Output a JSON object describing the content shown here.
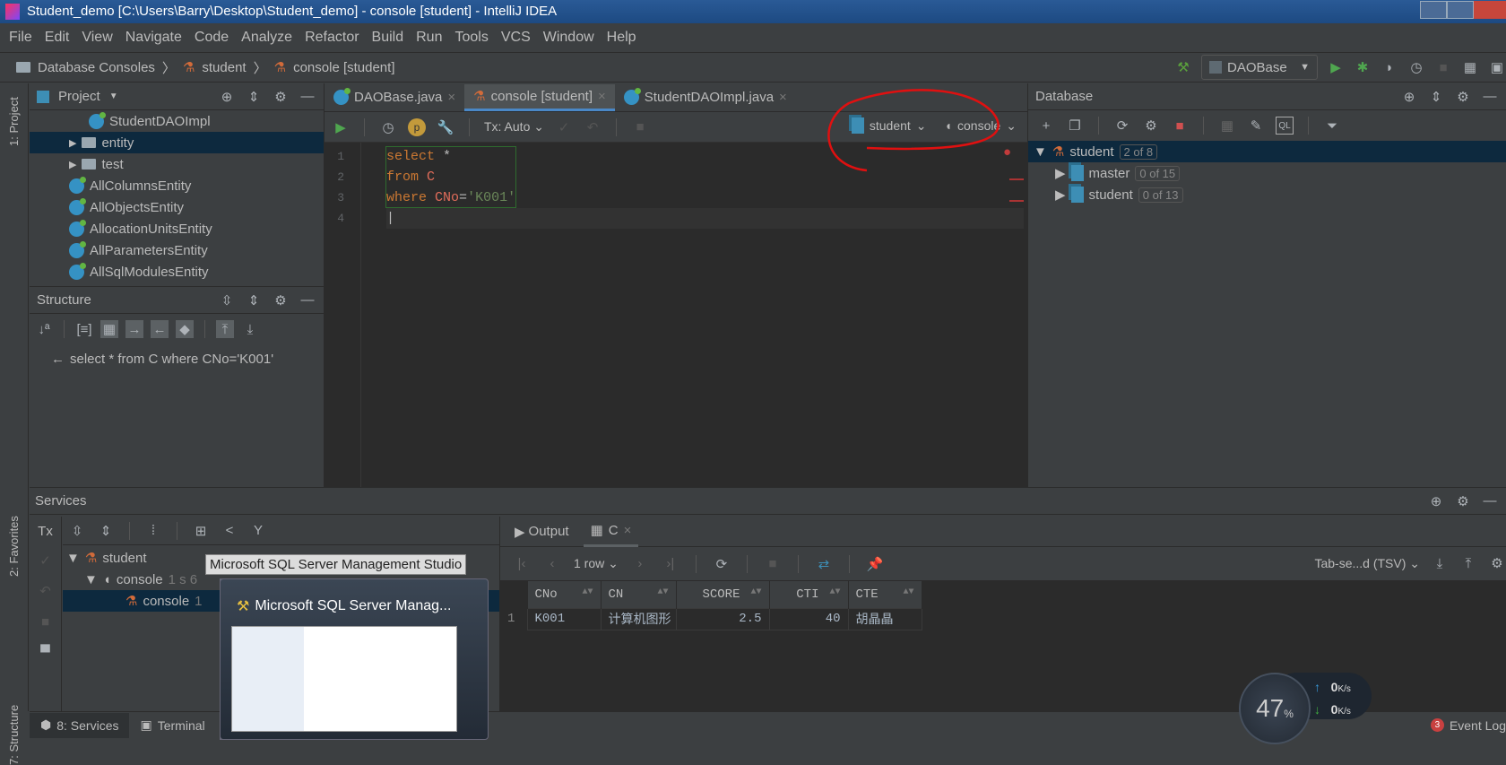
{
  "window": {
    "title": "Student_demo [C:\\Users\\Barry\\Desktop\\Student_demo] - console [student] - IntelliJ IDEA"
  },
  "menu": [
    "File",
    "Edit",
    "View",
    "Navigate",
    "Code",
    "Analyze",
    "Refactor",
    "Build",
    "Run",
    "Tools",
    "VCS",
    "Window",
    "Help"
  ],
  "breadcrumb": [
    "Database Consoles",
    "student",
    "console [student]"
  ],
  "run_config": "DAOBase",
  "side_tabs": {
    "project": "1: Project",
    "favorites": "2: Favorites",
    "structure": "7: Structure"
  },
  "project": {
    "title": "Project",
    "items": [
      {
        "label": "StudentDAOImpl",
        "type": "class",
        "indent": 3
      },
      {
        "label": "entity",
        "type": "folder",
        "indent": 2,
        "selected": true
      },
      {
        "label": "test",
        "type": "folder",
        "indent": 2
      },
      {
        "label": "AllColumnsEntity",
        "type": "class",
        "indent": 2
      },
      {
        "label": "AllObjectsEntity",
        "type": "class",
        "indent": 2
      },
      {
        "label": "AllocationUnitsEntity",
        "type": "class",
        "indent": 2
      },
      {
        "label": "AllParametersEntity",
        "type": "class",
        "indent": 2
      },
      {
        "label": "AllSqlModulesEntity",
        "type": "class",
        "indent": 2
      }
    ]
  },
  "structure": {
    "title": "Structure",
    "item": "select * from C where CNo='K001'"
  },
  "editor": {
    "tabs": [
      "DAOBase.java",
      "console [student]",
      "StudentDAOImpl.java"
    ],
    "active_tab": 1,
    "tx_mode": "Tx: Auto",
    "datasource": "student",
    "session": "console",
    "lines": [
      "1",
      "2",
      "3",
      "4"
    ]
  },
  "database": {
    "title": "Database",
    "root": {
      "label": "student",
      "badge": "2 of 8"
    },
    "children": [
      {
        "label": "master",
        "badge": "0 of 15"
      },
      {
        "label": "student",
        "badge": "0 of 13"
      }
    ]
  },
  "services": {
    "title": "Services",
    "tx": "Tx",
    "tree": [
      {
        "label": "student"
      },
      {
        "label": "console",
        "suffix": "1 s 6"
      },
      {
        "label": "console",
        "suffix": "1"
      }
    ],
    "tabs": [
      "Output",
      "C"
    ],
    "rows_label": "1 row",
    "format": "Tab-se...d (TSV)",
    "columns": [
      "CNo",
      "CN",
      "SCORE",
      "CTI",
      "CTE"
    ],
    "rows": [
      {
        "n": "1",
        "CNo": "K001",
        "CN": "计算机图形",
        "SCORE": "2.5",
        "CTI": "40",
        "CTE": "胡晶晶"
      }
    ]
  },
  "tooltip": "Microsoft SQL Server Management Studio",
  "taskbar_preview": {
    "title": "Microsoft SQL Server Manag..."
  },
  "bottom": {
    "services": "8: Services",
    "terminal": "Terminal",
    "event_log": "Event Log",
    "event_count": "3"
  },
  "netmeter": {
    "cpu": "47",
    "cpu_unit": "%",
    "up": "0",
    "down": "0",
    "unit": "K/s"
  }
}
